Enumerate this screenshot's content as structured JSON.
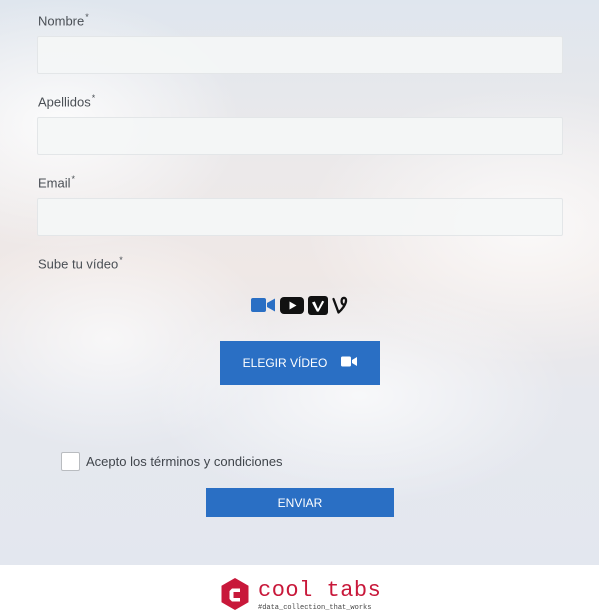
{
  "form": {
    "first_name": {
      "label": "Nombre",
      "required_mark": "*",
      "value": "",
      "placeholder": ""
    },
    "last_name": {
      "label": "Apellidos",
      "required_mark": "*",
      "value": "",
      "placeholder": ""
    },
    "email": {
      "label": "Email",
      "required_mark": "*",
      "value": "",
      "placeholder": ""
    },
    "video": {
      "label": "Sube tu vídeo",
      "required_mark": "*",
      "source_icons": [
        "video-camera-icon",
        "youtube-icon",
        "vimeo-icon",
        "vine-icon"
      ],
      "choose_button_label": "ELEGIR VÍDEO",
      "choose_button_icon": "video-camera-icon"
    },
    "terms": {
      "label": "Acepto los términos y condiciones",
      "checked": false
    },
    "submit_label": "ENVIAR"
  },
  "footer": {
    "brand_name": "cool tabs",
    "tagline": "#data_collection_that_works"
  },
  "colors": {
    "primary_button": "#2a6fc4",
    "brand": "#c8183a",
    "label_text": "#4a4f55"
  }
}
